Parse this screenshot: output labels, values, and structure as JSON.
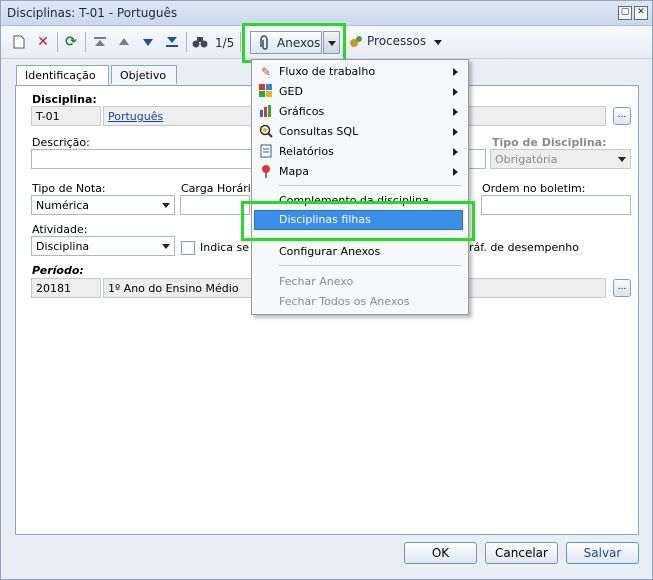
{
  "window": {
    "title": "Disciplinas: T-01 - Português",
    "btn_restore": "▢",
    "btn_close": "✕"
  },
  "toolbar": {
    "counter": "1/5",
    "anexos_label": "Anexos",
    "processos_label": "Processos"
  },
  "tabs": [
    {
      "label": "Identificação"
    },
    {
      "label": "Objetivo"
    }
  ],
  "form": {
    "disciplina_label": "Disciplina:",
    "disciplina_code": "T-01",
    "disciplina_name": "Português",
    "descricao_label": "Descrição:",
    "tipo_disciplina_label": "Tipo de Disciplina:",
    "tipo_disciplina_value": "Obrigatória",
    "tipo_nota_label": "Tipo de Nota:",
    "tipo_nota_value": "Numérica",
    "carga_horaria_label": "Carga Horária:",
    "ordem_label": "Ordem no boletim:",
    "atividade_label": "Atividade:",
    "atividade_value": "Disciplina",
    "indica_label": "Indica se i",
    "graf_label": "ráf. de desempenho",
    "periodo_label": "Período:",
    "periodo_code": "20181",
    "periodo_name": "1º Ano do Ensino Médio",
    "ellipsis": "..."
  },
  "menu": {
    "items": [
      {
        "label": "Fluxo de trabalho"
      },
      {
        "label": "GED"
      },
      {
        "label": "Gráficos"
      },
      {
        "label": "Consultas SQL"
      },
      {
        "label": "Relatórios"
      },
      {
        "label": "Mapa"
      },
      {
        "label": "Complemento da disciplina"
      },
      {
        "label": "Disciplinas filhas"
      },
      {
        "label": "Configurar Anexos"
      },
      {
        "label": "Fechar Anexo"
      },
      {
        "label": "Fechar Todos os Anexos"
      }
    ]
  },
  "buttons": {
    "ok": "OK",
    "cancel": "Cancelar",
    "save": "Salvar"
  }
}
